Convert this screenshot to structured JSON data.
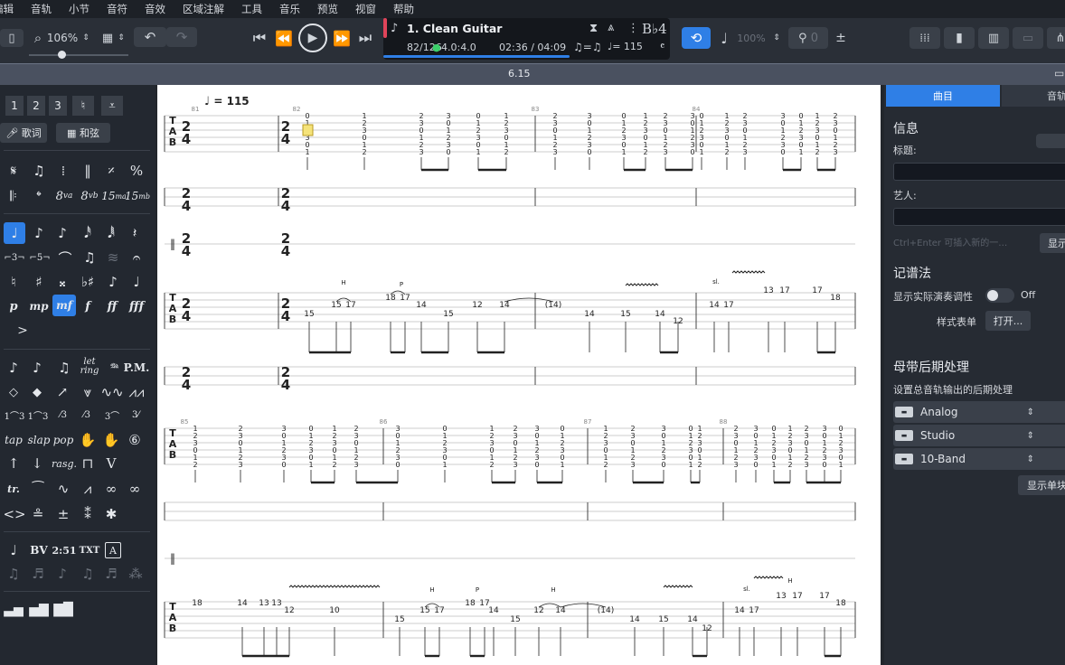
{
  "menu": {
    "items": [
      "编辑",
      "音轨",
      "小节",
      "音符",
      "音效",
      "区域注解",
      "工具",
      "音乐",
      "预览",
      "视窗",
      "帮助"
    ]
  },
  "toolbar": {
    "zoom": "106%",
    "tempo_value": "115",
    "metronome": "100%",
    "count_in": "0",
    "key": "B♭4"
  },
  "display": {
    "track_name": "1. Clean Guitar",
    "bar": "82/126",
    "signature": "4.0:4.0",
    "time": "02:36 / 04:09",
    "tempo": "= 115",
    "triplet": "♫=♫"
  },
  "ruler": {
    "position": "6.15"
  },
  "left_panel": {
    "strings": [
      "1",
      "2",
      "3",
      "4"
    ],
    "lyrics_label": "歌词",
    "chord_label": "和弦",
    "row_symbols": [
      "P.M.",
      "tap",
      "slap",
      "pop",
      "BV",
      "2:51",
      "TXT",
      "A",
      "let ring",
      "rasg.",
      "8va",
      "8vb",
      "15ma",
      "15mb",
      "p",
      "mp",
      "mf",
      "f",
      "ff",
      "fff",
      "tr."
    ]
  },
  "score": {
    "tempo_mark": "= 115",
    "measure_numbers": [
      "81",
      "82",
      "83",
      "84",
      "85",
      "86",
      "87",
      "88"
    ],
    "techniques": [
      "H",
      "P",
      "H",
      "P",
      "H",
      "H",
      "sl.",
      "sl."
    ],
    "numbers": [
      "0",
      "1",
      "2",
      "3",
      "10",
      "12",
      "13",
      "14",
      "15",
      "17",
      "18",
      "(14)"
    ]
  },
  "right_panel": {
    "tabs": [
      "曲目",
      "音轨"
    ],
    "info_header": "信息",
    "title_label": "标题:",
    "artist_label": "艺人:",
    "placeholder": "Ctrl+Enter 可插入新的一…",
    "show_button": "显示",
    "notation_header": "记谱法",
    "notation_toggle_label": "显示实际演奏调性",
    "toggle_state": "Off",
    "stylesheet_label": "样式表单",
    "open_button": "打开...",
    "mastering_header": "母带后期处理",
    "mastering_desc": "设置总音轨输出的后期处理",
    "effects": [
      "Analog",
      "Studio",
      "10-Band"
    ],
    "show_single_button": "显示单块"
  },
  "colors": {
    "accent": "#2f7fe6",
    "score_bg": "#ffffff",
    "panel_bg": "#262b33"
  }
}
